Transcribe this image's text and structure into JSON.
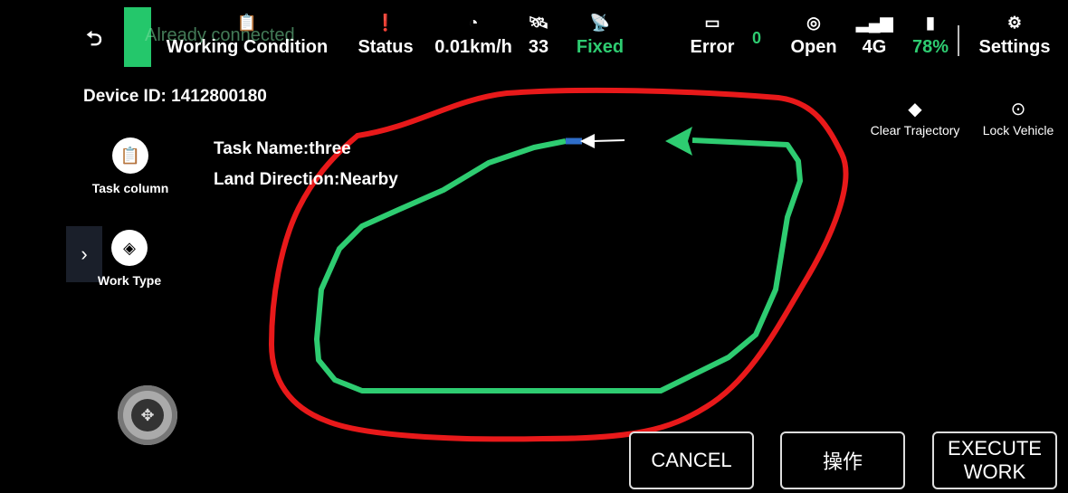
{
  "topbar": {
    "toast": "Already connected",
    "working_condition": "Working Condition",
    "status": "Status",
    "speed": "0.01km/h",
    "satellites": "33",
    "fix": "Fixed",
    "error_label": "Error",
    "error_count": "0",
    "open_label": "Open",
    "network": "4G",
    "battery": "78%",
    "settings": "Settings"
  },
  "device": {
    "id_text": "Device ID: 1412800180"
  },
  "sidebar": {
    "task_column": "Task column",
    "work_type": "Work Type"
  },
  "task": {
    "name": "Task Name:three",
    "land_direction": "Land Direction:Nearby"
  },
  "tools": {
    "clear_trajectory": "Clear Trajectory",
    "lock_vehicle": "Lock Vehicle"
  },
  "actions": {
    "cancel": "CANCEL",
    "operate": "操作",
    "execute_line1": "EXECUTE",
    "execute_line2": "WORK"
  },
  "colors": {
    "boundary": "#e8191a",
    "trajectory": "#2ecc71",
    "accent_green": "#24c76b"
  }
}
